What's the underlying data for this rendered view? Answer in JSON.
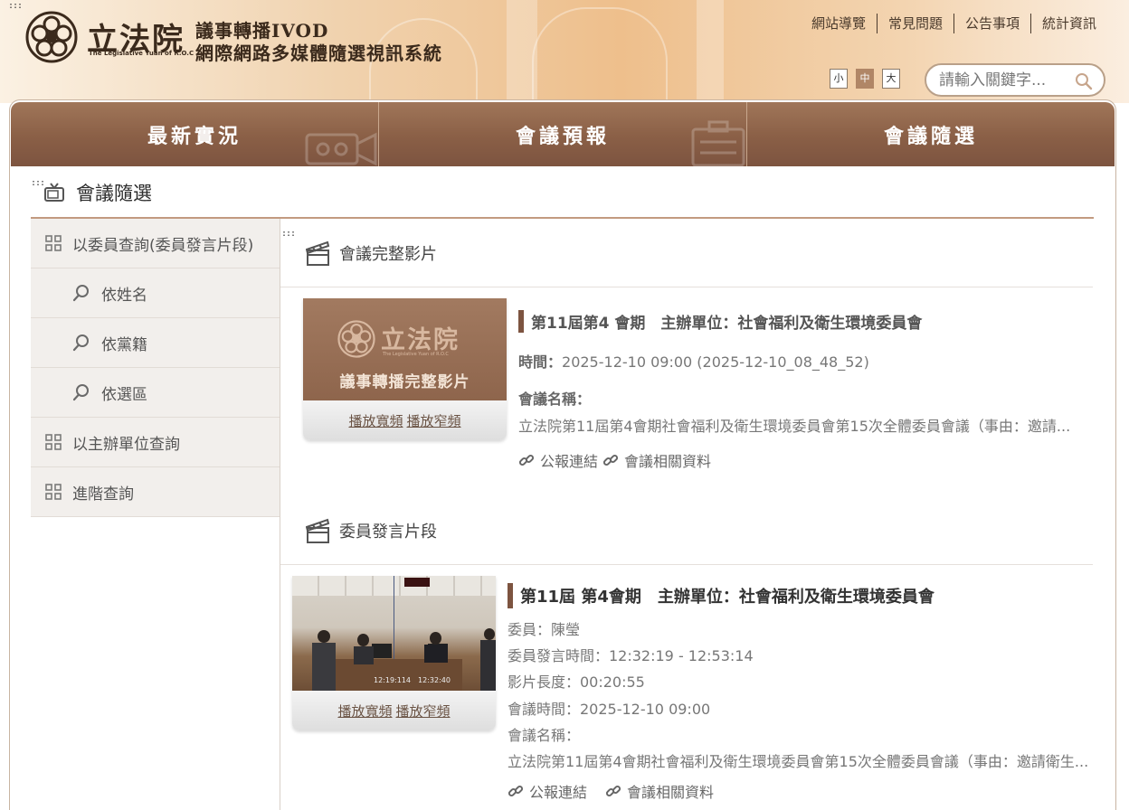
{
  "header": {
    "logo_cn": "立法院",
    "logo_en": "The Legislative Yuan of R.O.C",
    "subtitle_1": "議事轉播IVOD",
    "subtitle_2": "網際網路多媒體隨選視訊系統",
    "skip_marker": ":::",
    "top_links": [
      "網站導覽",
      "常見問題",
      "公告事項",
      "統計資訊"
    ],
    "font_sizes": [
      "小",
      "中",
      "大"
    ],
    "active_font_size": "中",
    "search_placeholder": "請輸入關鍵字..."
  },
  "nav": {
    "tabs": [
      "最新實況",
      "會議預報",
      "會議隨選"
    ]
  },
  "page": {
    "title": "會議隨選",
    "skip_marker": ":::"
  },
  "sidebar": {
    "items": [
      {
        "label": "以委員查詢(委員發言片段)",
        "type": "main",
        "icon": "grid-icon"
      },
      {
        "label": "依姓名",
        "type": "sub",
        "icon": "search-icon"
      },
      {
        "label": "依黨籍",
        "type": "sub",
        "icon": "search-icon"
      },
      {
        "label": "依選區",
        "type": "sub",
        "icon": "search-icon"
      },
      {
        "label": "以主辦單位查詢",
        "type": "main",
        "icon": "grid-icon"
      },
      {
        "label": "進階查詢",
        "type": "main",
        "icon": "grid-icon"
      }
    ]
  },
  "full_video": {
    "section_title": "會議完整影片",
    "skip_marker": ":::",
    "thumb_logo": "立法院",
    "thumb_logo_en": "The Legislative Yuan of R.O.C",
    "thumb_caption": "議事轉播完整影片",
    "play_wide": "播放寬頻",
    "play_narrow": "播放窄頻",
    "title": "第11屆第4 會期　主辦單位：社會福利及衛生環境委員會",
    "time_label": "時間：",
    "time_value": "2025-12-10 09:00 (2025-12-10_08_48_52)",
    "meeting_name_label": "會議名稱：",
    "meeting_name": "立法院第11屆第4會期社會福利及衛生環境委員會第15次全體委員會議（事由：邀請...",
    "link_gazette": "公報連結",
    "link_related": "會議相關資料"
  },
  "clip": {
    "section_title": "委員發言片段",
    "thumb_timestamp": "12:19:114　12:32:40",
    "play_wide": "播放寬頻",
    "play_narrow": "播放窄頻",
    "title": "第11屆 第4會期　主辦單位：社會福利及衛生環境委員會",
    "member": "委員：陳瑩",
    "speak_time": "委員發言時間：12:32:19 - 12:53:14",
    "duration": "影片長度：00:20:55",
    "meeting_time": "會議時間：2025-12-10 09:00",
    "meeting_name_label": "會議名稱：",
    "meeting_name": "立法院第11屆第4會期社會福利及衛生環境委員會第15次全體委員會議（事由：邀請衛生...",
    "link_gazette": "公報連結",
    "link_related": "會議相關資料"
  }
}
